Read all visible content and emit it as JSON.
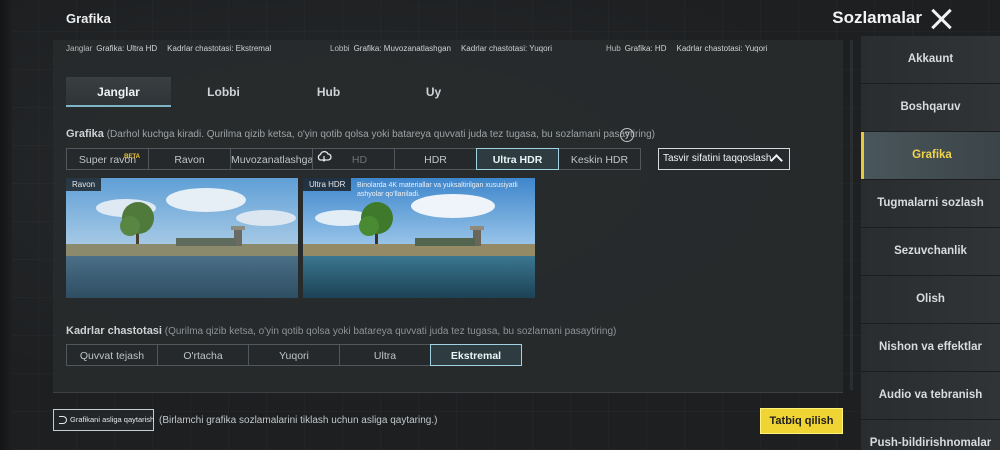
{
  "header": {
    "title": "Grafika",
    "settings_title": "Sozlamalar"
  },
  "summary": [
    {
      "key": "Janglar",
      "value": "Grafika: Ultra HD"
    },
    {
      "key": "",
      "value": "Kadrlar chastotasi: Ekstremal"
    },
    {
      "key": "Lobbi",
      "value": "Grafika: Muvozanatlashgan"
    },
    {
      "key": "",
      "value": "Kadrlar chastotasi: Yuqori"
    },
    {
      "key": "Hub",
      "value": "Grafika: HD"
    },
    {
      "key": "",
      "value": "Kadrlar chastotasi: Yuqori"
    }
  ],
  "tabs": [
    "Janglar",
    "Lobbi",
    "Hub",
    "Uy"
  ],
  "active_tab": "Janglar",
  "graphics": {
    "label": "Grafika",
    "hint": "(Darhol kuchga kiradi. Qurilma qizib ketsa, o'yin qotib qolsa yoki batareya quvvati juda tez tugasa, bu sozlamani pasaytiring)",
    "options": [
      "Super ravon",
      "Ravon",
      "Muvozanatlashgan",
      "HD",
      "HDR",
      "Ultra HDR",
      "Keskin HDR"
    ],
    "beta_label": "BETA",
    "selected": "Ultra HDR",
    "compare_label": "Tasvir sifatini taqqoslash"
  },
  "preview": {
    "left_caption": "Ravon",
    "right_caption": "Ultra HDR",
    "right_desc": "Binolarda 4K materiallar va yuksaltirilgan xususiyatli ashyolar qo'llaniladi."
  },
  "fps": {
    "label": "Kadrlar chastotasi",
    "hint": "(Qurilma qizib ketsa, o'yin qotib qolsa yoki batareya quvvati juda tez tugasa, bu sozlamani pasaytiring)",
    "options": [
      "Quvvat tejash",
      "O'rtacha",
      "Yuqori",
      "Ultra",
      "Ekstremal"
    ],
    "selected": "Ekstremal"
  },
  "footer": {
    "reset_label": "Grafikani asliga qaytarish",
    "reset_hint": "(Birlamchi grafika sozlamalarini tiklash uchun asliga qaytaring.)",
    "apply_label": "Tatbiq qilish"
  },
  "sidebar": {
    "items": [
      "Akkaunt",
      "Boshqaruv",
      "Grafika",
      "Tugmalarni sozlash",
      "Sezuvchanlik",
      "Olish",
      "Nishon va effektlar",
      "Audio va tebranish",
      "Push-bildirishnomalar"
    ],
    "active": "Grafika"
  },
  "colors": {
    "accent": "#9fd3e2",
    "apply": "#f0d434",
    "active_side_text": "#f3d54d"
  },
  "icons": [
    "close-icon",
    "help-icon",
    "cloud-icon",
    "chevron-up-icon",
    "undo-icon"
  ]
}
